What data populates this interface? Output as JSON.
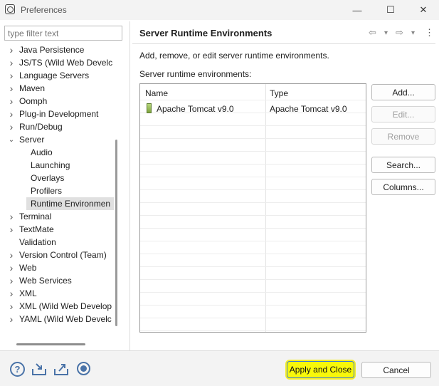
{
  "window": {
    "title": "Preferences",
    "minimize": "—",
    "maximize": "☐",
    "close": "✕"
  },
  "filter": {
    "placeholder": "type filter text",
    "value": ""
  },
  "tree": [
    {
      "label": "Java Persistence",
      "expandable": true,
      "level": 0
    },
    {
      "label": "JS/TS (Wild Web Develc",
      "expandable": true,
      "level": 0
    },
    {
      "label": "Language Servers",
      "expandable": true,
      "level": 0
    },
    {
      "label": "Maven",
      "expandable": true,
      "level": 0
    },
    {
      "label": "Oomph",
      "expandable": true,
      "level": 0
    },
    {
      "label": "Plug-in Development",
      "expandable": true,
      "level": 0
    },
    {
      "label": "Run/Debug",
      "expandable": true,
      "level": 0
    },
    {
      "label": "Server",
      "expandable": true,
      "expanded": true,
      "level": 0
    },
    {
      "label": "Audio",
      "expandable": false,
      "level": 1
    },
    {
      "label": "Launching",
      "expandable": false,
      "level": 1
    },
    {
      "label": "Overlays",
      "expandable": false,
      "level": 1
    },
    {
      "label": "Profilers",
      "expandable": false,
      "level": 1
    },
    {
      "label": "Runtime Environmen",
      "expandable": false,
      "level": 1,
      "selected": true
    },
    {
      "label": "Terminal",
      "expandable": true,
      "level": 0
    },
    {
      "label": "TextMate",
      "expandable": true,
      "level": 0
    },
    {
      "label": "Validation",
      "expandable": false,
      "level": 0
    },
    {
      "label": "Version Control (Team)",
      "expandable": true,
      "level": 0
    },
    {
      "label": "Web",
      "expandable": true,
      "level": 0
    },
    {
      "label": "Web Services",
      "expandable": true,
      "level": 0
    },
    {
      "label": "XML",
      "expandable": true,
      "level": 0
    },
    {
      "label": "XML (Wild Web Develop",
      "expandable": true,
      "level": 0
    },
    {
      "label": "YAML (Wild Web Develc",
      "expandable": true,
      "level": 0
    }
  ],
  "page": {
    "title": "Server Runtime Environments",
    "description": "Add, remove, or edit server runtime environments.",
    "table_label": "Server runtime environments:",
    "nav": {
      "back": "⇦",
      "back_menu": "▾",
      "forward": "⇨",
      "forward_menu": "▾",
      "more": "⋮"
    }
  },
  "table": {
    "columns": [
      "Name",
      "Type"
    ],
    "rows": [
      {
        "name": "Apache Tomcat v9.0",
        "type": "Apache Tomcat v9.0"
      }
    ]
  },
  "buttons": {
    "add": "Add...",
    "edit": "Edit...",
    "remove": "Remove",
    "search": "Search...",
    "columns": "Columns..."
  },
  "bottom": {
    "help": "?",
    "apply_close": "Apply and Close",
    "cancel": "Cancel"
  },
  "colors": {
    "highlight": "#f8f80a",
    "focus_border": "#3c7bd4",
    "icon_blue": "#4a73a8"
  }
}
